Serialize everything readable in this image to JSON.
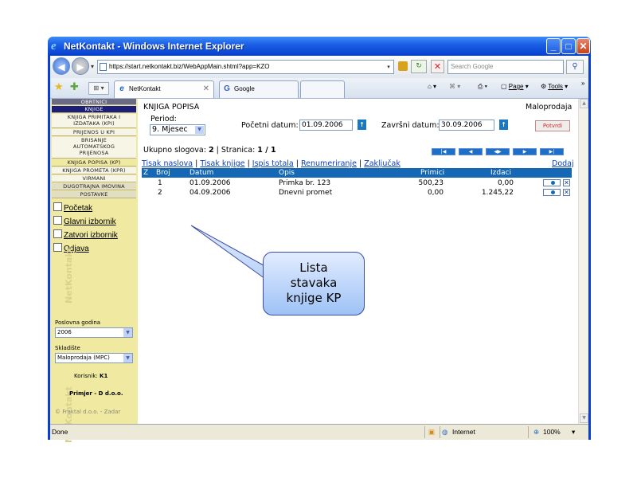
{
  "window": {
    "title": "NetKontakt - Windows Internet Explorer"
  },
  "address_bar": {
    "url": "https://start.netkontakt.biz/WebAppMain.shtml?app=KZO",
    "search_placeholder": "Search Google"
  },
  "tabs": [
    {
      "label": "NetKontakt"
    },
    {
      "label": "Google"
    }
  ],
  "command_bar": {
    "page": "Page",
    "tools": "Tools"
  },
  "sidebar": {
    "menu": [
      "OBRTNICI",
      "KNJIGE",
      "KNJIGA PRIMITAKA I",
      "IZDATAKA (KPI)",
      "PRIJENOS U KPI",
      "BRISANJE",
      "AUTOMATSKOG",
      "PRIJENOSA",
      "KNJIGA POPISA (KP)",
      "KNJIGA PROMETA (KPR)",
      "VIRMANI",
      "DUGOTRAJNA IMOVINA",
      "POSTAVKE"
    ],
    "links": {
      "pocetak": "Početak",
      "glavni": "Glavni izbornik",
      "zatvori": "Zatvori izbornik",
      "odjava": "Odjava"
    },
    "poslovna_godina_label": "Poslovna godina",
    "poslovna_godina_value": "2006",
    "skladiste_label": "Skladište",
    "skladiste_value": "Maloprodaja (MPC)",
    "korisnik_label": "Korisnik:",
    "korisnik_value": "K1",
    "company": "Primjer - D d.o.o.",
    "copyright": "© Fraktal d.o.o. - Zadar",
    "watermark": "NetKontakt"
  },
  "main": {
    "title": "KNJIGA POPISA",
    "subtitle": "Maloprodaja",
    "period_label": "Period:",
    "period_value": "9. Mjesec",
    "pocetni_label": "Početni datum:",
    "pocetni_value": "01.09.2006",
    "zavrsni_label": "Završni datum:",
    "zavrsni_value": "30.09.2006",
    "potvrdi": "Potvrdi",
    "ukupno_label": "Ukupno slogova:",
    "ukupno_value": "2",
    "stranica_label": "| Stranica:",
    "stranica_value": "1 / 1",
    "links": [
      "Tisak naslova",
      "Tisak knjige",
      "Ispis totala",
      "Renumeriranje",
      "Zaključak"
    ],
    "dodaj": "Dodaj",
    "columns": [
      "Z",
      "Broj",
      "Datum",
      "Opis",
      "Primici",
      "Izdaci"
    ],
    "rows": [
      {
        "broj": "1",
        "datum": "01.09.2006",
        "opis": "Primka br. 123",
        "primici": "500,23",
        "izdaci": "0,00"
      },
      {
        "broj": "2",
        "datum": "04.09.2006",
        "opis": "Dnevni promet",
        "primici": "0,00",
        "izdaci": "1.245,22"
      }
    ]
  },
  "statusbar": {
    "status": "Done",
    "zone": "Internet",
    "zoom": "100%"
  },
  "callout": {
    "text": "Lista\nstavaka\nknjige KP"
  }
}
